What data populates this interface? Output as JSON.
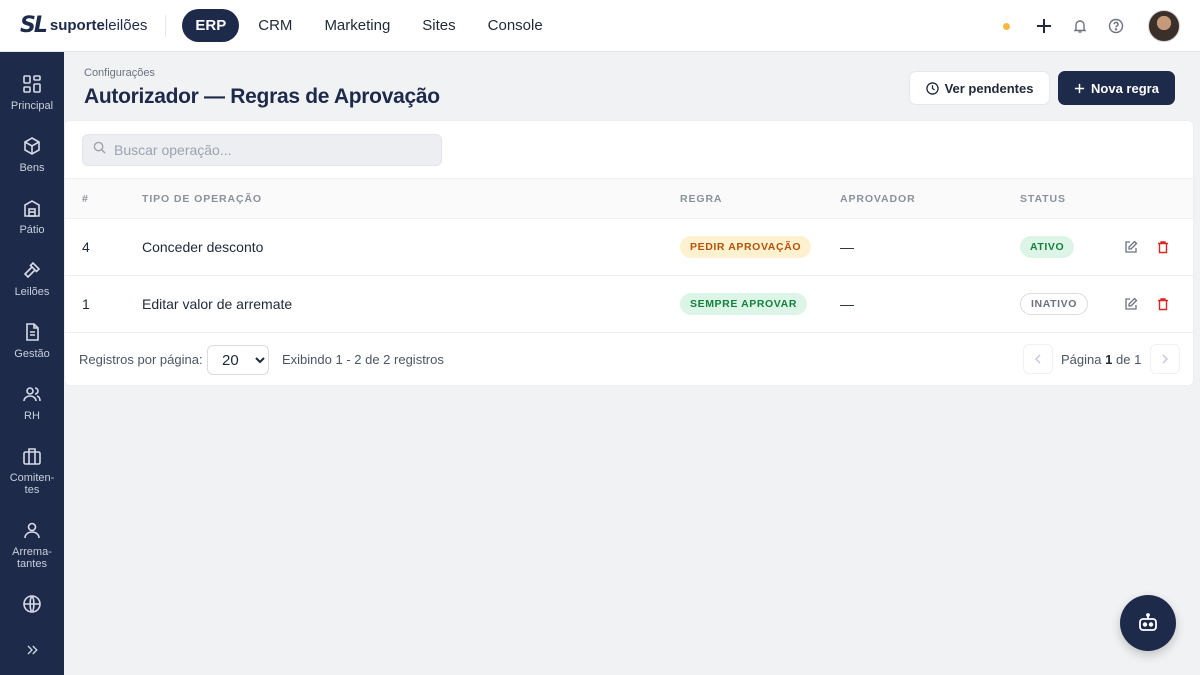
{
  "brand": {
    "mark": "SL",
    "name_bold": "suporte",
    "name_light": "leilões"
  },
  "topnav": [
    {
      "label": "ERP",
      "active": true
    },
    {
      "label": "CRM",
      "active": false
    },
    {
      "label": "Marketing",
      "active": false
    },
    {
      "label": "Sites",
      "active": false
    },
    {
      "label": "Console",
      "active": false
    }
  ],
  "top_icons": [
    "status-dot",
    "plus-icon",
    "bell-icon",
    "help-icon",
    "avatar"
  ],
  "sidebar": [
    {
      "label": "Principal",
      "icon": "dashboard-icon"
    },
    {
      "label": "Bens",
      "icon": "box-icon"
    },
    {
      "label": "Pátio",
      "icon": "warehouse-icon"
    },
    {
      "label": "Leilões",
      "icon": "gavel-icon"
    },
    {
      "label": "Gestão",
      "icon": "document-icon"
    },
    {
      "label": "RH",
      "icon": "users-icon"
    },
    {
      "label": "Comiten-\ntes",
      "icon": "briefcase-icon"
    },
    {
      "label": "Arrema-\ntantes",
      "icon": "user-icon"
    },
    {
      "label": "",
      "icon": "globe-icon"
    },
    {
      "label": "",
      "icon": "chevrons-right-icon"
    }
  ],
  "header": {
    "breadcrumb": "Configurações",
    "title": "Autorizador — Regras de Aprovação",
    "pending_button": "Ver pendentes",
    "new_button": "Nova regra"
  },
  "search": {
    "placeholder": "Buscar operação...",
    "value": ""
  },
  "table": {
    "headers": {
      "id": "#",
      "type": "TIPO DE OPERAÇÃO",
      "rule": "REGRA",
      "approver": "APROVADOR",
      "status": "STATUS"
    },
    "rows": [
      {
        "id": "4",
        "type": "Conceder desconto",
        "rule": "PEDIR APROVAÇÃO",
        "rule_color": "yellow",
        "approver": "—",
        "status": "ATIVO",
        "status_color": "green"
      },
      {
        "id": "1",
        "type": "Editar valor de arremate",
        "rule": "SEMPRE APROVAR",
        "rule_color": "green",
        "approver": "—",
        "status": "INATIVO",
        "status_color": "gray"
      }
    ]
  },
  "footer": {
    "per_page_label": "Registros por página:",
    "per_page_value": "20",
    "info": "Exibindo 1 - 2 de 2 registros",
    "page_prefix": "Página",
    "page_current": "1",
    "page_of": "de",
    "page_total": "1"
  },
  "colors": {
    "navy": "#1e2a4a",
    "accent_dot": "#f5b942",
    "delete": "#dc2626"
  }
}
